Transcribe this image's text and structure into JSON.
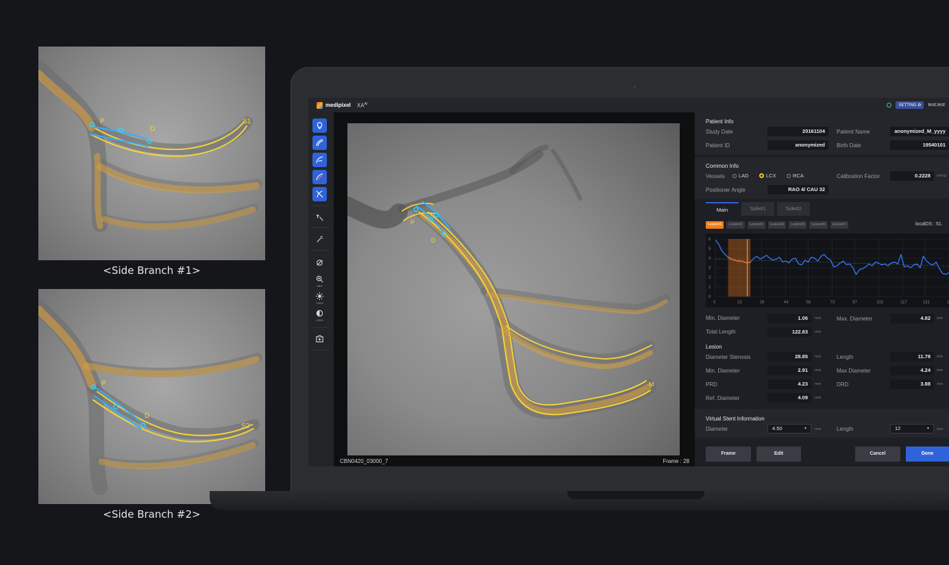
{
  "captions": {
    "side1": "<Side Branch #1>",
    "side2": "<Side Branch #2>"
  },
  "thumbnails": {
    "side1": {
      "labels": {
        "p": "P",
        "d": "D",
        "end": "S1"
      }
    },
    "side2": {
      "labels": {
        "p": "P",
        "d": "D",
        "end": "S2"
      }
    }
  },
  "app": {
    "brand": "medipixel",
    "product": "XA",
    "product_sup": "AI",
    "setting_label": "SETTING ⚙",
    "user": "test.test",
    "status_color": "#37d27a",
    "accent": "#2f63d9"
  },
  "toolbar": {
    "tools": [
      {
        "icon": "bulb-icon",
        "active": true
      },
      {
        "icon": "vessel-curve-icon",
        "active": true
      },
      {
        "icon": "vessel-branch-icon",
        "active": true
      },
      {
        "icon": "vessel-edit-icon",
        "active": true
      },
      {
        "icon": "vessel-erase-icon",
        "active": true
      },
      {
        "icon": "pointer-magic-icon",
        "active": false
      },
      {
        "icon": "wand-icon",
        "active": false
      },
      {
        "icon": "hide-icon",
        "active": false
      },
      {
        "icon": "zoom-icon",
        "active": false,
        "pct": "98%"
      },
      {
        "icon": "brightness-icon",
        "active": false,
        "pct": "100%"
      },
      {
        "icon": "contrast-icon",
        "active": false,
        "pct": "100%"
      },
      {
        "icon": "capture-icon",
        "active": false
      }
    ]
  },
  "viewer": {
    "id": "CBN0420_03000_7",
    "frame": "Frame : 28",
    "labels": {
      "p": "P",
      "d": "D",
      "m": "M"
    }
  },
  "patient": {
    "title": "Patient Info",
    "study_date_label": "Study Date",
    "study_date": "20161104",
    "name_label": "Patient Name",
    "name": "anonymized_M_yyyy",
    "id_label": "Patient ID",
    "id": "anonymized",
    "birth_label": "Birth Date",
    "birth": "19540101"
  },
  "common": {
    "title": "Common Info",
    "vessels_label": "Vessels",
    "vessels": [
      "LAD",
      "LCX",
      "RCA"
    ],
    "vessel_selected": "LCX",
    "calib_label": "Calibration Factor",
    "calib": "0.2228",
    "calib_unit": "mm/p",
    "angle_label": "Positioner Angle",
    "angle": "RAO 4/ CAU 32"
  },
  "tabs": [
    "Main",
    "Side#1",
    "Side#2"
  ],
  "active_tab": "Main",
  "lesions": [
    "Lesion#1",
    "Lesion#2",
    "Lesion#3",
    "Lesion#4",
    "Lesion#5",
    "Lesion#6",
    "Lesion#7"
  ],
  "active_lesion": "Lesion#1",
  "local_ds": "localDS : 51.",
  "chart_data": {
    "type": "line",
    "xticks": [
      "0",
      "15",
      "29",
      "44",
      "58",
      "73",
      "87",
      "102",
      "117",
      "131",
      "146"
    ],
    "yticks": [
      "0",
      "1",
      "2",
      "3",
      "4",
      "5",
      "6"
    ],
    "ylim": [
      0,
      6
    ],
    "xlim": [
      0,
      146
    ],
    "lesion_range": [
      8,
      22
    ],
    "lesion_marker": 20,
    "series": [
      {
        "color": "#2f7bff",
        "x": [
          0,
          2,
          4,
          6,
          8,
          10,
          12,
          14,
          16,
          18,
          20,
          22,
          24,
          26,
          28,
          30,
          32,
          34,
          36,
          38,
          40,
          42,
          44,
          46,
          48,
          50,
          52,
          54,
          56,
          58,
          60,
          62,
          64,
          66,
          68,
          70,
          72,
          74,
          76,
          78,
          80,
          82,
          84,
          86,
          88,
          90,
          92,
          94,
          96,
          98,
          100,
          102,
          104,
          106,
          108,
          110,
          112,
          114,
          116,
          118,
          120,
          122,
          124,
          126,
          128,
          130,
          132,
          134,
          136,
          138,
          140,
          142,
          144,
          146
        ],
        "values": [
          5.9,
          5.5,
          4.8,
          4.4,
          4.1,
          3.9,
          3.8,
          3.7,
          3.7,
          3.6,
          3.5,
          3.6,
          4.0,
          4.2,
          3.9,
          4.1,
          4.3,
          4.0,
          3.8,
          3.9,
          4.1,
          3.6,
          3.7,
          3.5,
          3.9,
          4.0,
          3.4,
          3.3,
          3.8,
          3.6,
          4.1,
          4.0,
          3.7,
          4.2,
          4.4,
          4.0,
          3.8,
          3.1,
          3.2,
          3.5,
          3.7,
          3.3,
          3.4,
          3.0,
          2.3,
          2.8,
          2.9,
          3.1,
          3.4,
          3.2,
          3.6,
          3.5,
          3.3,
          3.4,
          3.2,
          3.5,
          3.6,
          3.4,
          4.4,
          3.1,
          3.2,
          3.0,
          3.3,
          3.4,
          3.0,
          4.2,
          3.7,
          3.4,
          3.3,
          3.6,
          2.9,
          2.4,
          2.3,
          2.5
        ]
      },
      {
        "color": "#ff7b2c",
        "x": [
          8,
          10,
          12,
          14,
          16,
          18,
          20,
          22
        ],
        "values": [
          4.1,
          3.9,
          3.8,
          3.7,
          3.7,
          3.6,
          3.5,
          3.6
        ]
      }
    ]
  },
  "measures": {
    "min_d_label": "Min. Diameter",
    "min_d": "1.06",
    "unit": "mm",
    "max_d_label": "Max. Diameter",
    "max_d": "4.82",
    "total_len_label": "Total Length",
    "total_len": "122.83"
  },
  "lesion": {
    "title": "Lesion",
    "ds_label": "Diameter Stenosis",
    "ds": "28.85",
    "ds_unit": "mm",
    "len_label": "Length",
    "len": "11.78",
    "min_label": "Min. Diameter",
    "min": "2.91",
    "max_label": "Max Diameter",
    "max": "4.24",
    "prd_label": "PRD",
    "prd": "4.23",
    "drd_label": "DRD",
    "drd": "3.88",
    "ref_label": "Ref. Diameter",
    "ref": "4.09"
  },
  "stent": {
    "title": "Virtual Stent Information",
    "diam_label": "Diameter",
    "diam": "4.50",
    "len_label": "Length",
    "len": "12",
    "unit": "mm"
  },
  "buttons": {
    "frame": "Frame",
    "edit": "Edit",
    "cancel": "Cancel",
    "done": "Done"
  }
}
